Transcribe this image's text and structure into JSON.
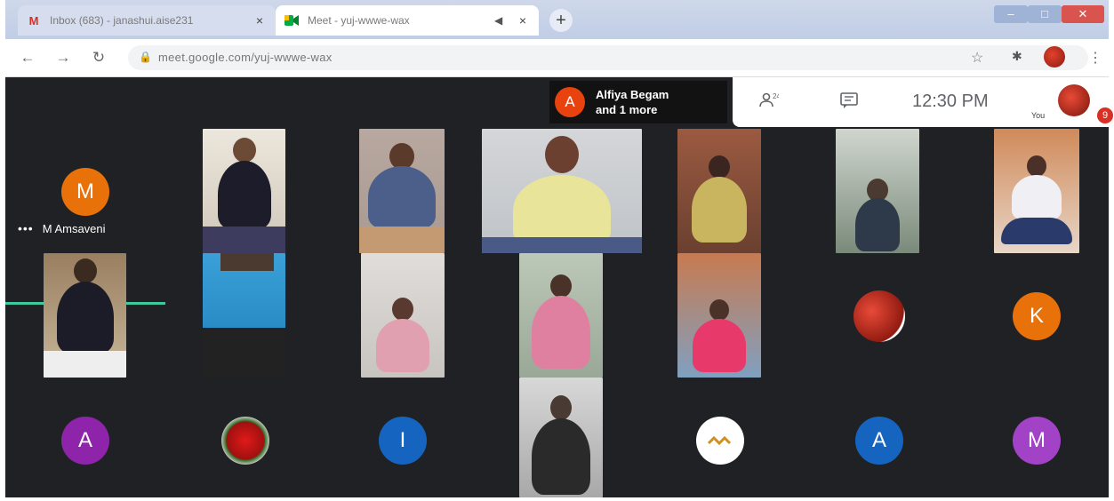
{
  "browser": {
    "tabs": [
      {
        "title": "Inbox (683) - janashui.aise231",
        "favicon": "gmail-icon"
      },
      {
        "title": "Meet - yuj-wwwe-wax",
        "favicon": "meet-icon"
      }
    ],
    "url": "meet.google.com/yuj-wwwe-wax",
    "new_tab_symbol": "+",
    "close_symbol": "×"
  },
  "meet": {
    "presenter": {
      "initial": "A",
      "name": "Alfiya Begam",
      "more": "and 1 more",
      "color": "#e8430f"
    },
    "time": "12:30 PM",
    "you_label": "You",
    "notification_count": "9",
    "speaking": {
      "initial": "M",
      "name": "M Amsaveni",
      "color": "#e8710a"
    },
    "avatars": [
      {
        "initial": "K",
        "color": "#e8710a"
      },
      {
        "initial": "A",
        "color": "#8e24aa"
      },
      {
        "initial": "I",
        "color": "#1565c0"
      },
      {
        "initial": "A",
        "color": "#1565c0"
      },
      {
        "initial": "M",
        "color": "#a142c7"
      }
    ]
  }
}
